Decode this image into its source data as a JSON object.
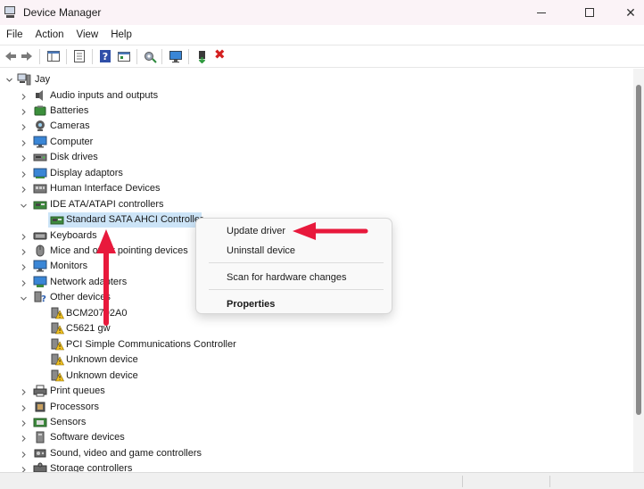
{
  "window": {
    "title": "Device Manager",
    "minimize_icon": "minimize-icon",
    "maximize_icon": "maximize-icon",
    "close_glyph": "✕"
  },
  "menu": [
    "File",
    "Action",
    "View",
    "Help"
  ],
  "toolbar": {
    "icons": [
      "back-arrow-icon",
      "forward-arrow-icon",
      "show-hide-tree-icon",
      "properties-icon",
      "help-icon",
      "update-driver-icon",
      "scan-hardware-icon",
      "monitor-icon",
      "enable-device-icon",
      "uninstall-device-icon"
    ],
    "uninstall_glyph": "✖"
  },
  "tree": {
    "root": "Jay",
    "items": [
      {
        "label": "Audio inputs and outputs",
        "icon": "speaker-icon",
        "expanded": false
      },
      {
        "label": "Batteries",
        "icon": "battery-icon",
        "expanded": false
      },
      {
        "label": "Cameras",
        "icon": "camera-icon",
        "expanded": false
      },
      {
        "label": "Computer",
        "icon": "computer-icon",
        "expanded": false
      },
      {
        "label": "Disk drives",
        "icon": "disk-drive-icon",
        "expanded": false
      },
      {
        "label": "Display adaptors",
        "icon": "display-adapter-icon",
        "expanded": false
      },
      {
        "label": "Human Interface Devices",
        "icon": "hid-icon",
        "expanded": false
      },
      {
        "label": "IDE ATA/ATAPI controllers",
        "icon": "ide-controller-icon",
        "expanded": true
      },
      {
        "label": "Standard SATA AHCI Controller",
        "icon": "ide-controller-icon",
        "child": true,
        "selected": true
      },
      {
        "label": "Keyboards",
        "icon": "keyboard-icon",
        "expanded": false
      },
      {
        "label": "Mice and other pointing devices",
        "icon": "mouse-icon",
        "expanded": false
      },
      {
        "label": "Monitors",
        "icon": "monitor-icon",
        "expanded": false
      },
      {
        "label": "Network adapters",
        "icon": "network-adapter-icon",
        "expanded": false
      },
      {
        "label": "Other devices",
        "icon": "other-devices-icon",
        "expanded": true
      },
      {
        "label": "BCM20702A0",
        "icon": "warning-device-icon",
        "child": true
      },
      {
        "label": "C5621 gw",
        "icon": "warning-device-icon",
        "child": true
      },
      {
        "label": "PCI Simple Communications Controller",
        "icon": "warning-device-icon",
        "child": true
      },
      {
        "label": "Unknown device",
        "icon": "warning-device-icon",
        "child": true
      },
      {
        "label": "Unknown device",
        "icon": "warning-device-icon",
        "child": true
      },
      {
        "label": "Print queues",
        "icon": "printer-icon",
        "expanded": false
      },
      {
        "label": "Processors",
        "icon": "processor-icon",
        "expanded": false
      },
      {
        "label": "Sensors",
        "icon": "sensor-icon",
        "expanded": false
      },
      {
        "label": "Software devices",
        "icon": "software-device-icon",
        "expanded": false
      },
      {
        "label": "Sound, video and game controllers",
        "icon": "sound-icon",
        "expanded": false
      },
      {
        "label": "Storage controllers",
        "icon": "storage-controller-icon",
        "expanded": false
      }
    ]
  },
  "context_menu": {
    "update_driver": "Update driver",
    "uninstall_device": "Uninstall device",
    "scan_hardware": "Scan for hardware changes",
    "properties": "Properties"
  },
  "colors": {
    "selection": "#cce4f7",
    "annotation_arrow": "#e8193c",
    "titlebar_bg": "#fbf3f7"
  }
}
